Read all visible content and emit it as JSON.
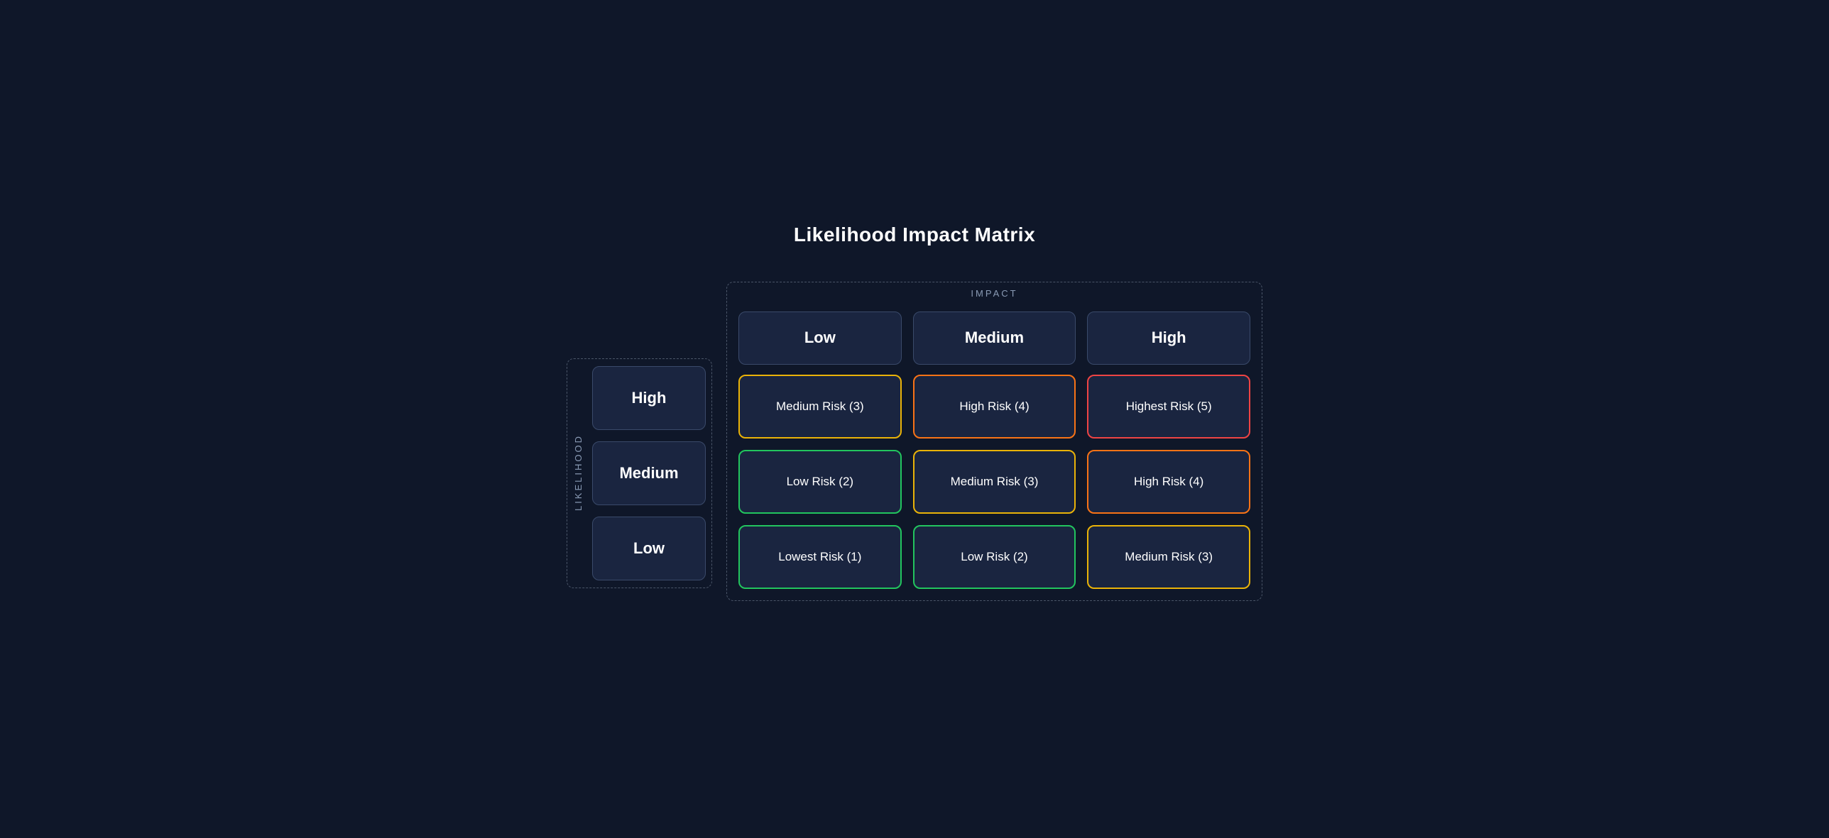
{
  "title": "Likelihood Impact Matrix",
  "impact_label": "IMPACT",
  "likelihood_label": "LIKELIHOOD",
  "col_headers": [
    {
      "id": "col-low",
      "label": "Low"
    },
    {
      "id": "col-medium",
      "label": "Medium"
    },
    {
      "id": "col-high",
      "label": "High"
    }
  ],
  "row_headers": [
    {
      "id": "row-high",
      "label": "High"
    },
    {
      "id": "row-medium",
      "label": "Medium"
    },
    {
      "id": "row-low",
      "label": "Low"
    }
  ],
  "cells": [
    {
      "id": "cell-high-low",
      "text": "Medium Risk (3)",
      "border": "yellow"
    },
    {
      "id": "cell-high-med",
      "text": "High Risk (4)",
      "border": "orange"
    },
    {
      "id": "cell-high-high",
      "text": "Highest Risk (5)",
      "border": "red"
    },
    {
      "id": "cell-med-low",
      "text": "Low Risk (2)",
      "border": "green"
    },
    {
      "id": "cell-med-med",
      "text": "Medium Risk (3)",
      "border": "yellow"
    },
    {
      "id": "cell-med-high",
      "text": "High Risk (4)",
      "border": "orange"
    },
    {
      "id": "cell-low-low",
      "text": "Lowest Risk (1)",
      "border": "green"
    },
    {
      "id": "cell-low-med",
      "text": "Low Risk (2)",
      "border": "green"
    },
    {
      "id": "cell-low-high",
      "text": "Medium Risk (3)",
      "border": "yellow"
    }
  ]
}
